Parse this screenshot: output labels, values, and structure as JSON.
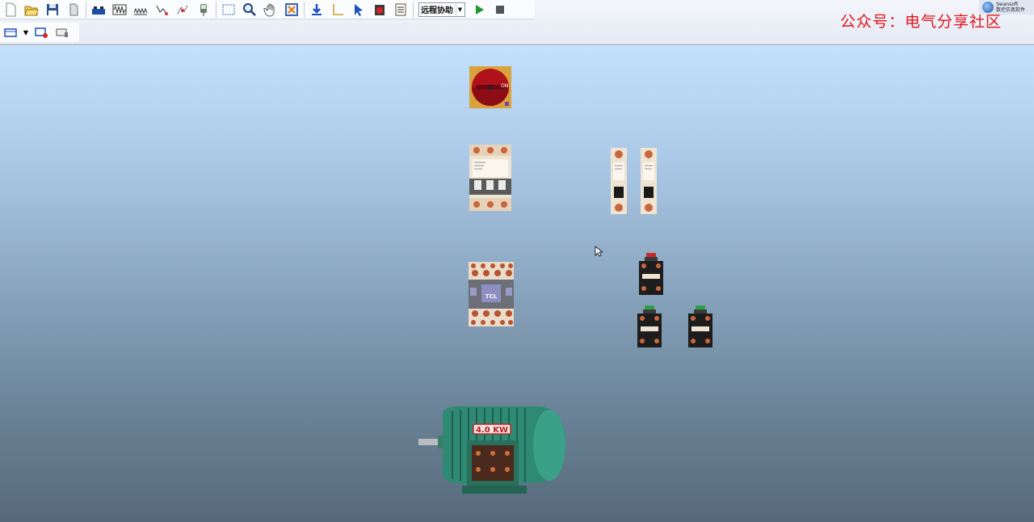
{
  "toolbar": {
    "remote_assist_label": "远程协助",
    "icons_row1": [
      "new-file-icon",
      "open-folder-icon",
      "save-icon",
      "export-icon",
      "power-supply-icon",
      "resistor-icon",
      "load-icon",
      "voltage-probe-icon",
      "current-probe-icon",
      "meter-icon",
      "select-rect-icon",
      "zoom-icon",
      "pan-hand-icon",
      "fit-view-icon",
      "download-icon",
      "axis-icon",
      "pointer-icon",
      "record-icon",
      "list-icon"
    ],
    "run_icon": "play-icon",
    "stop_icon": "stop-icon",
    "icons_row2": [
      "panel-icon",
      "panel-add-icon",
      "panel-settings-icon"
    ]
  },
  "watermark": "公众号：电气分享社区",
  "brand": {
    "name": "Swansoft",
    "subtitle": "数控仿真软件"
  },
  "components": {
    "motor_rating": "4.0 KW",
    "contactor_brand": "TCL"
  }
}
